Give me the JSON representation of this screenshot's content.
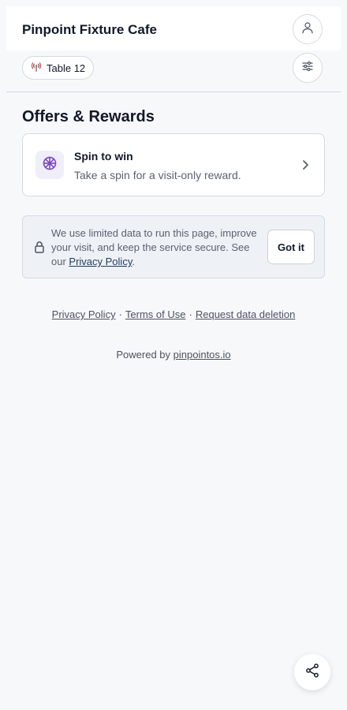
{
  "header": {
    "venue_name": "Pinpoint Fixture Cafe",
    "account_icon": "user-icon"
  },
  "table_chip": {
    "label": "Table 12",
    "icon": "signal-tower-icon"
  },
  "filter_icon": "sliders-icon",
  "offers": {
    "title": "Offers & Rewards",
    "items": [
      {
        "title": "Spin to win",
        "description": "Take a spin for a visit-only reward.",
        "icon": "wheel-icon"
      }
    ]
  },
  "privacy_notice": {
    "text_before": "We use limited data to run this page, improve your visit, and keep the service secure. See our ",
    "link_label": "Privacy Policy",
    "text_after": ".",
    "button_label": "Got it"
  },
  "footer": {
    "links": [
      "Privacy Policy",
      "Terms of Use",
      "Request data deletion"
    ],
    "separator": "·",
    "powered_prefix": "Powered by",
    "powered_link": "pinpointos.io"
  },
  "colors": {
    "accent_purple": "#7c4dbd",
    "signal_red": "#d64545",
    "background": "#f7f8fa"
  }
}
